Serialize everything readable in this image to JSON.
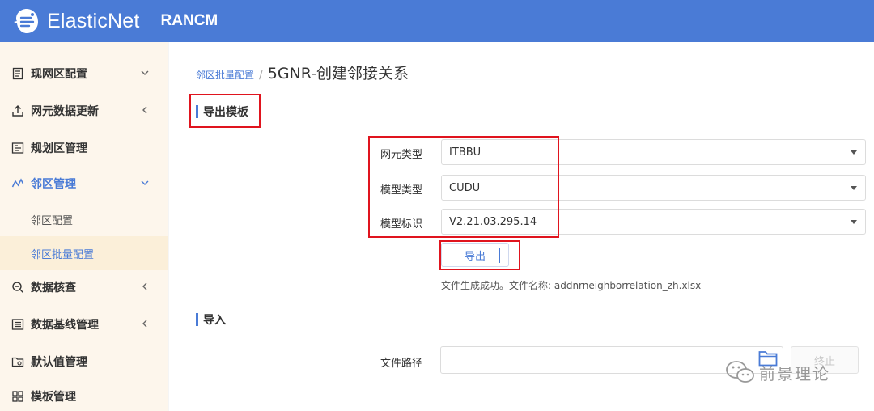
{
  "header": {
    "brand": "ElasticNet",
    "app_name": "RANCM"
  },
  "sidebar": {
    "items": [
      {
        "label": "现网区配置",
        "icon": "document-icon",
        "arrow": "down"
      },
      {
        "label": "网元数据更新",
        "icon": "upload-icon",
        "arrow": "left"
      },
      {
        "label": "规划区管理",
        "icon": "planning-icon",
        "arrow": ""
      },
      {
        "label": "邻区管理",
        "icon": "neighbor-icon",
        "arrow": "down",
        "active": true
      },
      {
        "label": "数据核查",
        "icon": "search-icon",
        "arrow": "left"
      },
      {
        "label": "数据基线管理",
        "icon": "list-icon",
        "arrow": "left"
      },
      {
        "label": "默认值管理",
        "icon": "folder-icon",
        "arrow": ""
      },
      {
        "label": "模板管理",
        "icon": "grid-icon",
        "arrow": ""
      }
    ],
    "sub_items": [
      {
        "label": "邻区配置"
      },
      {
        "label": "邻区批量配置",
        "selected": true
      }
    ]
  },
  "breadcrumb": {
    "parent": "邻区批量配置",
    "separator": "/",
    "current": "5GNR-创建邻接关系"
  },
  "export_section": {
    "title": "导出模板",
    "fields": [
      {
        "label": "网元类型",
        "value": "ITBBU"
      },
      {
        "label": "模型类型",
        "value": "CUDU"
      },
      {
        "label": "模型标识",
        "value": "V2.21.03.295.14"
      }
    ],
    "export_button": "导出",
    "success_message": "文件生成成功。文件名称: addnrneighborrelation_zh.xlsx"
  },
  "import_section": {
    "title": "导入",
    "path_label": "文件路径",
    "path_value": "",
    "stop_button": "终止"
  },
  "watermark": {
    "text": "前景理论"
  },
  "colors": {
    "header_bg": "#4a7bd6",
    "accent": "#4a7bd6",
    "sidebar_bg": "#fdf6ec",
    "highlight_red": "#e0141e"
  }
}
